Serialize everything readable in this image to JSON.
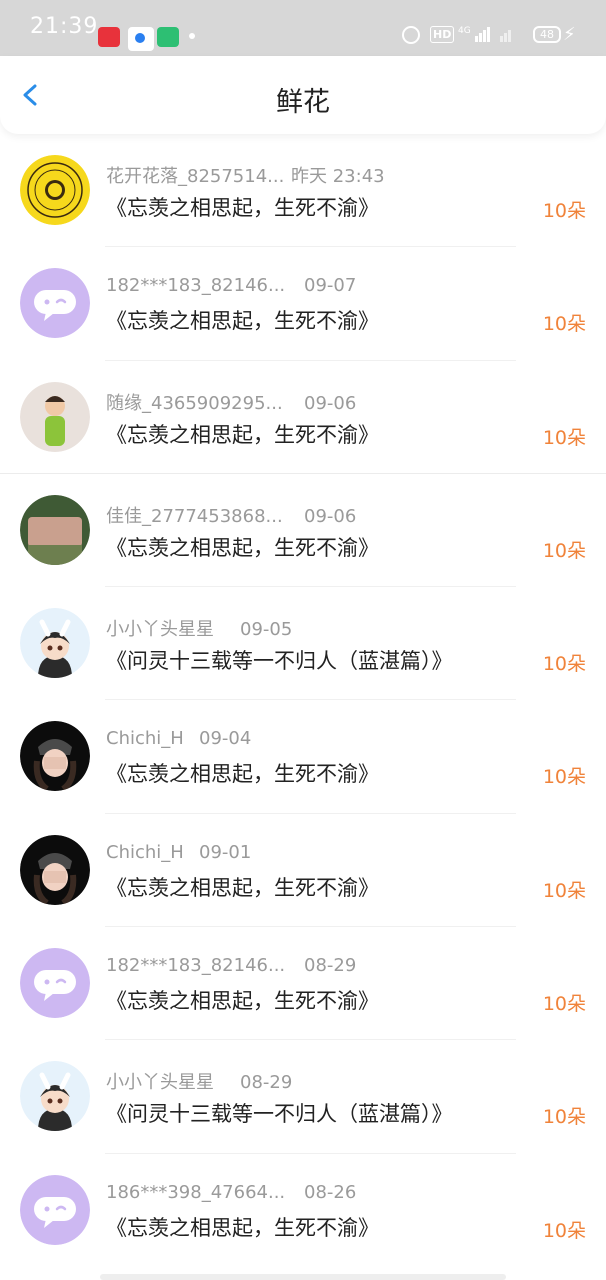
{
  "status": {
    "time": "21:39",
    "hd": "HD",
    "network": "4G",
    "battery": "48",
    "colors": {
      "bar": "#d7d7d7",
      "red_app": "#e8323b",
      "blue_app": "#2a7ff0",
      "green_app": "#2dbf73"
    }
  },
  "header": {
    "title": "鲜花",
    "back_icon": "chevron-left-icon",
    "accent": "#2a8de8"
  },
  "items": [
    {
      "name": "花开花落_8257514...",
      "date": "昨天 23:43",
      "work": "《忘羡之相思起，生死不渝》",
      "count": "10朵",
      "avatar": "yellow-seal"
    },
    {
      "name": "182***183_82146...",
      "date": "09-07",
      "work": "《忘羡之相思起，生死不渝》",
      "count": "10朵",
      "avatar": "purple-chat"
    },
    {
      "name": "随缘_4365909295...",
      "date": "09-06",
      "work": "《忘羡之相思起，生死不渝》",
      "count": "10朵",
      "avatar": "child-photo"
    },
    {
      "name": "佳佳_2777453868...",
      "date": "09-06",
      "work": "《忘羡之相思起，生死不渝》",
      "count": "10朵",
      "avatar": "stone-photo"
    },
    {
      "name": "小小丫头星星",
      "date": "09-05",
      "work": "《问灵十三载等一不归人（蓝湛篇）》",
      "count": "10朵",
      "avatar": "cartoon-girl"
    },
    {
      "name": "Chichi_H",
      "date": "09-04",
      "work": "《忘羡之相思起，生死不渝》",
      "count": "10朵",
      "avatar": "dark-girl"
    },
    {
      "name": "Chichi_H",
      "date": "09-01",
      "work": "《忘羡之相思起，生死不渝》",
      "count": "10朵",
      "avatar": "dark-girl"
    },
    {
      "name": "182***183_82146...",
      "date": "08-29",
      "work": "《忘羡之相思起，生死不渝》",
      "count": "10朵",
      "avatar": "purple-chat"
    },
    {
      "name": "小小丫头星星",
      "date": "08-29",
      "work": "《问灵十三载等一不归人（蓝湛篇）》",
      "count": "10朵",
      "avatar": "cartoon-girl"
    },
    {
      "name": "186***398_47664...",
      "date": "08-26",
      "work": "《忘羡之相思起，生死不渝》",
      "count": "10朵",
      "avatar": "purple-chat"
    }
  ]
}
